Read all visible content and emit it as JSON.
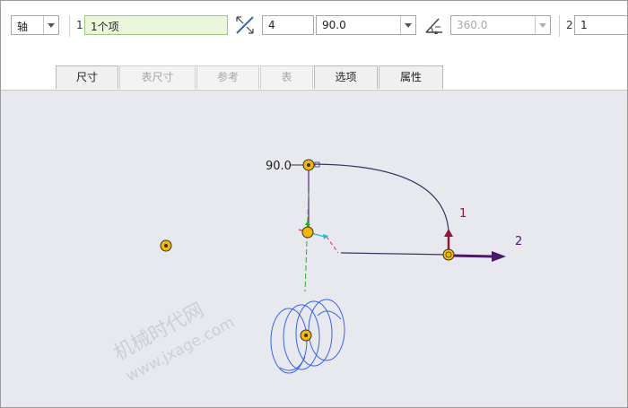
{
  "toolbar": {
    "type_select": {
      "value": "轴"
    },
    "refs_index": "1",
    "refs_value": "1个项",
    "count_value": "4",
    "angle_select": {
      "value": "90.0"
    },
    "total_angle_select": {
      "value": "360.0",
      "disabled": true
    },
    "second_index": "2",
    "second_value": "1"
  },
  "tabs": [
    {
      "label": "尺寸",
      "enabled": true
    },
    {
      "label": "表尺寸",
      "enabled": false
    },
    {
      "label": "参考",
      "enabled": false
    },
    {
      "label": "表",
      "enabled": false
    },
    {
      "label": "选项",
      "enabled": true
    },
    {
      "label": "属性",
      "enabled": true
    }
  ],
  "canvas": {
    "dimension_label": "90.0",
    "direction_label_1": "1",
    "direction_label_2": "2",
    "watermark_line1": "机械时代网",
    "watermark_line2": "www.jxage.com",
    "colors": {
      "arc": "#3a3560",
      "helix": "#3a64e8",
      "direction_arrow": "#4a1a6a",
      "handle": "#f5b800",
      "label_1": "#8b1a3a",
      "label_2": "#4a1a6a"
    }
  }
}
